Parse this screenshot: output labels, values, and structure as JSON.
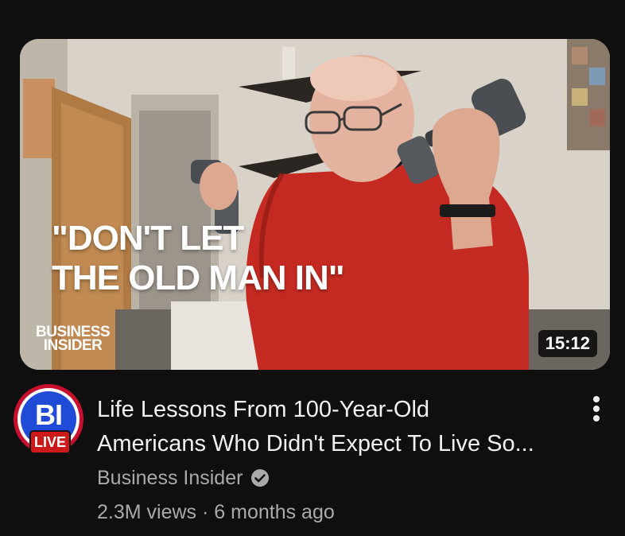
{
  "video": {
    "thumbnail_line1": "\"DON'T LET",
    "thumbnail_line2": "THE OLD MAN IN\"",
    "thumbnail_logo_line1": "BUSINESS",
    "thumbnail_logo_line2": "INSIDER",
    "duration": "15:12",
    "title_line1": "Life Lessons From 100-Year-Old",
    "title_line2": "Americans Who Didn't Expect To Live So..."
  },
  "channel": {
    "avatar_initials": "BI",
    "live_label": "LIVE",
    "name": "Business Insider",
    "verified_icon": "verified-check-icon"
  },
  "meta": {
    "views": "2.3M views",
    "separator": " · ",
    "age": "6 months ago"
  },
  "colors": {
    "background": "#0f0f0f",
    "title": "#f1f1f1",
    "secondary_text": "#aaaaaa",
    "live_red": "#cc1a1a",
    "avatar_blue": "#1f4bd6"
  }
}
